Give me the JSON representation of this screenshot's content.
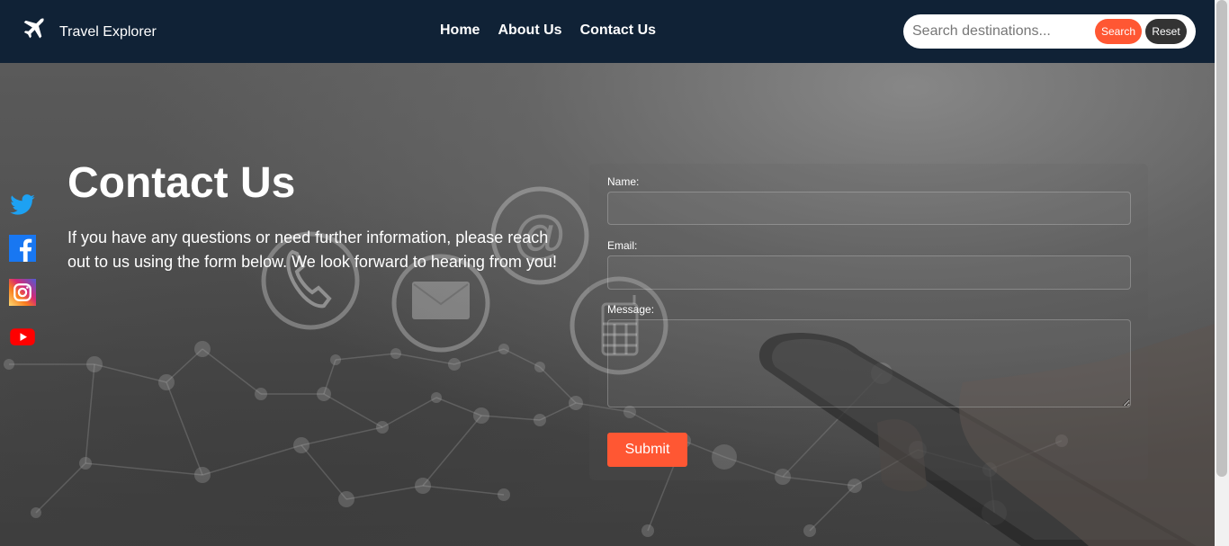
{
  "header": {
    "brand_name": "Travel Explorer",
    "nav": [
      {
        "label": "Home"
      },
      {
        "label": "About Us"
      },
      {
        "label": "Contact Us"
      }
    ],
    "search": {
      "placeholder": "Search destinations...",
      "search_label": "Search",
      "reset_label": "Reset"
    }
  },
  "social": [
    "twitter-icon",
    "facebook-icon",
    "instagram-icon",
    "youtube-icon"
  ],
  "contact": {
    "title": "Contact Us",
    "text": "If you have any questions or need further information, please reach out to us using the form below. We look forward to hearing from you!"
  },
  "form": {
    "name_label": "Name:",
    "email_label": "Email:",
    "message_label": "Message:",
    "submit_label": "Submit"
  },
  "colors": {
    "navbar": "#102236",
    "accent": "#ff5733"
  }
}
